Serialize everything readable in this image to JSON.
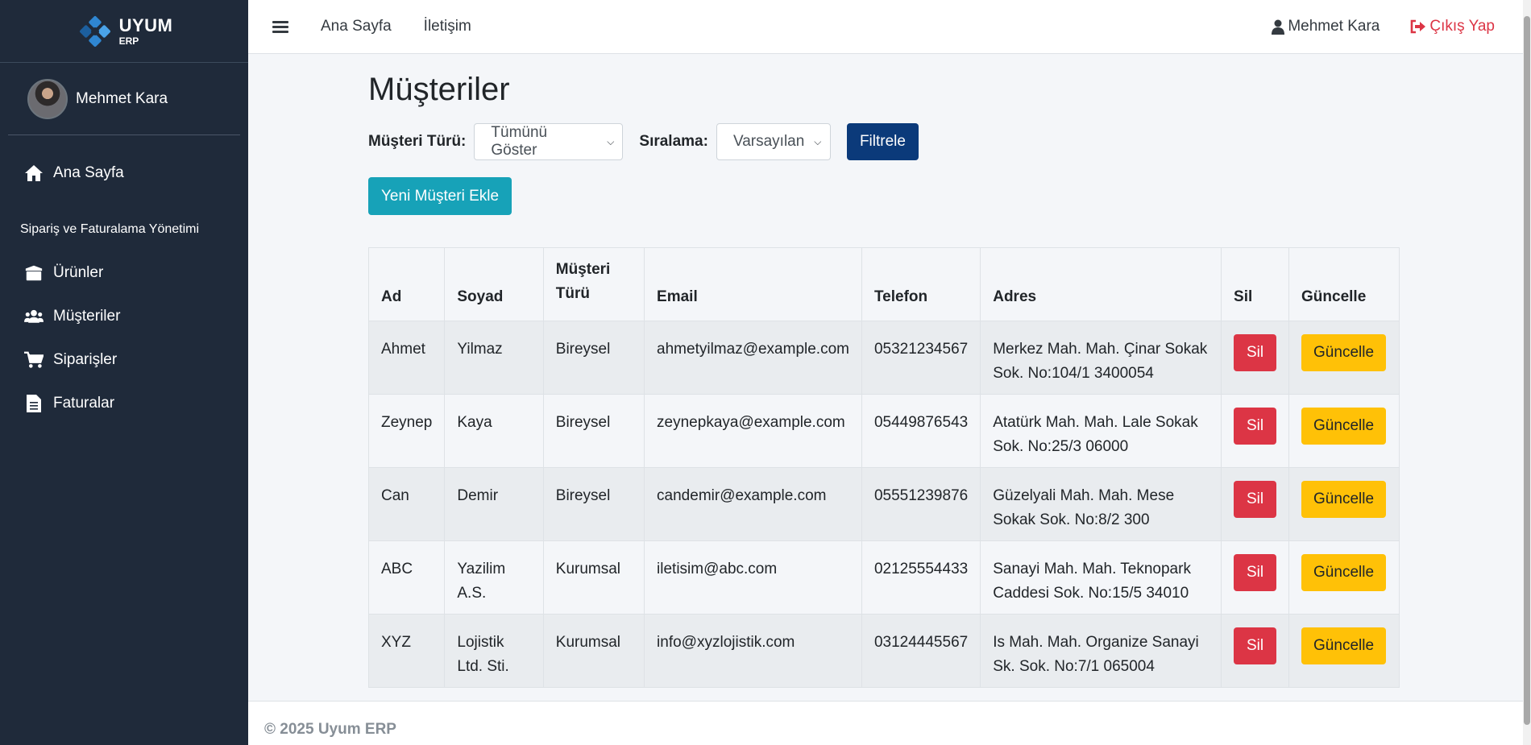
{
  "brand": {
    "name": "UYUM",
    "sub": "ERP"
  },
  "user": {
    "name": "Mehmet Kara"
  },
  "sidebar": {
    "home": "Ana Sayfa",
    "section_header": "Sipariş ve Faturalama Yönetimi",
    "items": [
      {
        "label": "Ürünler",
        "icon": "box-icon"
      },
      {
        "label": "Müşteriler",
        "icon": "users-icon"
      },
      {
        "label": "Siparişler",
        "icon": "cart-icon"
      },
      {
        "label": "Faturalar",
        "icon": "invoice-icon"
      }
    ]
  },
  "topbar": {
    "links": [
      "Ana Sayfa",
      "İletişim"
    ],
    "user": "Mehmet Kara",
    "logout": "Çıkış Yap"
  },
  "page": {
    "title": "Müşteriler",
    "filter_type_label": "Müşteri Türü:",
    "filter_type_value": "Tümünü Göster",
    "sort_label": "Sıralama:",
    "sort_value": "Varsayılan",
    "filter_button": "Filtrele",
    "add_button": "Yeni Müşteri Ekle"
  },
  "table": {
    "headers": [
      "Ad",
      "Soyad",
      "Müşteri Türü",
      "Email",
      "Telefon",
      "Adres",
      "Sil",
      "Güncelle"
    ],
    "delete_label": "Sil",
    "update_label": "Güncelle",
    "rows": [
      [
        "Ahmet",
        "Yilmaz",
        "Bireysel",
        "ahmetyilmaz@example.com",
        "05321234567",
        "Merkez Mah. Mah. Çinar Sokak Sok. No:104/1 3400054"
      ],
      [
        "Zeynep",
        "Kaya",
        "Bireysel",
        "zeynepkaya@example.com",
        "05449876543",
        "Atatürk Mah. Mah. Lale Sokak Sok. No:25/3 06000"
      ],
      [
        "Can",
        "Demir",
        "Bireysel",
        "candemir@example.com",
        "05551239876",
        "Güzelyali Mah. Mah. Mese Sokak Sok. No:8/2 300"
      ],
      [
        "ABC",
        "Yazilim A.S.",
        "Kurumsal",
        "iletisim@abc.com",
        "02125554433",
        "Sanayi Mah. Mah. Teknopark Caddesi Sok. No:15/5 34010"
      ],
      [
        "XYZ",
        "Lojistik Ltd. Sti.",
        "Kurumsal",
        "info@xyzlojistik.com",
        "03124445567",
        "Is Mah. Mah. Organize Sanayi Sk. Sok. No:7/1 065004"
      ]
    ]
  },
  "footer": "© 2025 Uyum ERP",
  "colors": {
    "sidebar": "#1f2a3a",
    "danger": "#dc3545",
    "warning": "#ffc107",
    "info": "#17a2b8",
    "primary": "#0b3a7a"
  }
}
